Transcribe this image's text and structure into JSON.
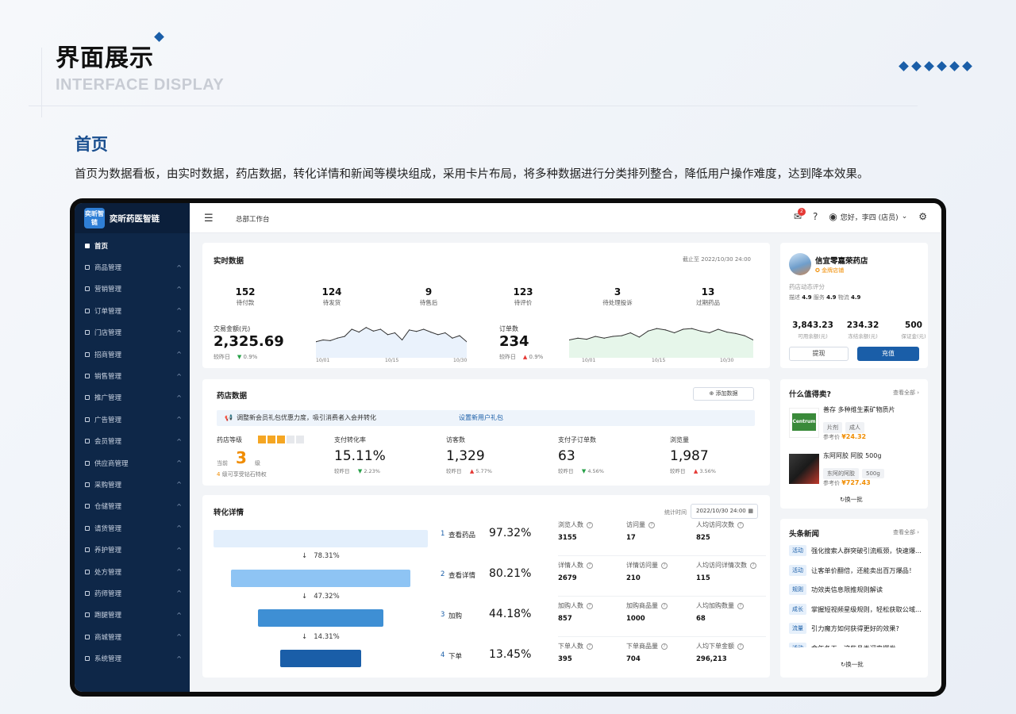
{
  "header": {
    "title": "界面展示",
    "subtitle": "INTERFACE DISPLAY",
    "section_title": "首页",
    "section_desc": "首页为数据看板，由实时数据，药店数据，转化详情和新闻等模块组成，采用卡片布局，将多种数据进行分类排列整合，降低用户操作难度，达到降本效果。"
  },
  "colors": {
    "primary": "#1a5ea8",
    "sidebar": "#0e2748",
    "up": "#e53935",
    "down": "#27a048",
    "price": "#f08c00"
  },
  "app": {
    "brand": "奕昕药医智链",
    "logo_text": "奕昕智链",
    "breadcrumb": "总部工作台",
    "notif_count": "2",
    "help": "?",
    "user": "您好，李四 (店员)",
    "user_chevron": "⌄"
  },
  "sidebar": {
    "items": [
      {
        "label": "首页",
        "active": true
      },
      {
        "label": "商品管理"
      },
      {
        "label": "营销管理"
      },
      {
        "label": "订单管理"
      },
      {
        "label": "门店管理"
      },
      {
        "label": "招商管理"
      },
      {
        "label": "销售管理"
      },
      {
        "label": "推广管理"
      },
      {
        "label": "广告管理"
      },
      {
        "label": "会员管理"
      },
      {
        "label": "供应商管理"
      },
      {
        "label": "采购管理"
      },
      {
        "label": "仓储管理"
      },
      {
        "label": "请货管理"
      },
      {
        "label": "养护管理"
      },
      {
        "label": "处方管理"
      },
      {
        "label": "药师管理"
      },
      {
        "label": "跑腿管理"
      },
      {
        "label": "商城管理"
      },
      {
        "label": "系统管理"
      }
    ]
  },
  "realtime": {
    "title": "实时数据",
    "as_of": "截止至 2022/10/30 24:00",
    "stats": [
      {
        "value": "152",
        "label": "待付款"
      },
      {
        "value": "124",
        "label": "待发货"
      },
      {
        "value": "9",
        "label": "待售后"
      },
      {
        "value": "123",
        "label": "待评价"
      },
      {
        "value": "3",
        "label": "待处理投诉"
      },
      {
        "value": "13",
        "label": "过期药品"
      }
    ],
    "amount": {
      "label": "交易金额(元)",
      "value": "2,325.69",
      "cmp_label": "较昨日",
      "change": "0.9%",
      "ticks": [
        "10/01",
        "10/15",
        "10/30"
      ]
    },
    "orders": {
      "label": "订单数",
      "value": "234",
      "cmp_label": "较昨日",
      "change": "0.9%",
      "ticks": [
        "10/01",
        "10/15",
        "10/30"
      ]
    }
  },
  "store": {
    "title": "药店数据",
    "add_btn": "添加数据",
    "notice": "调整新会员礼包优惠力度，吸引消费者入会并转化",
    "notice_link": "设置新用户礼包",
    "level_label": "药店等级",
    "level_prefix": "当前",
    "level_value": "3",
    "level_suffix": "级",
    "level_tip": "级可享受钻石特权",
    "level_tip_num": "4",
    "level_filled": 3,
    "level_total": 5,
    "metrics": [
      {
        "label": "支付转化率",
        "value": "15.11%",
        "cmp": "较昨日",
        "change": "2.23%",
        "dir": "down"
      },
      {
        "label": "访客数",
        "value": "1,329",
        "cmp": "较昨日",
        "change": "5.77%",
        "dir": "up"
      },
      {
        "label": "支付子订单数",
        "value": "63",
        "cmp": "较昨日",
        "change": "4.56%",
        "dir": "down"
      },
      {
        "label": "浏览量",
        "value": "1,987",
        "cmp": "较昨日",
        "change": "3.56%",
        "dir": "up"
      }
    ]
  },
  "conversion": {
    "title": "转化详情",
    "time_label": "统计时间",
    "date": "2022/10/30 24:00",
    "funnel_pcts": [
      "78.31%",
      "47.32%",
      "14.31%"
    ],
    "rows": [
      {
        "idx": "1",
        "name": "查看药品",
        "pct": "97.32%",
        "cells": [
          {
            "l": "浏览人数",
            "v": "3155"
          },
          {
            "l": "访问量",
            "v": "17"
          },
          {
            "l": "人均访问次数",
            "v": "825"
          }
        ]
      },
      {
        "idx": "2",
        "name": "查看详情",
        "pct": "80.21%",
        "cells": [
          {
            "l": "详情人数",
            "v": "2679"
          },
          {
            "l": "详情访问量",
            "v": "210"
          },
          {
            "l": "人均访问详情次数",
            "v": "115"
          }
        ]
      },
      {
        "idx": "3",
        "name": "加购",
        "pct": "44.18%",
        "cells": [
          {
            "l": "加购人数",
            "v": "857"
          },
          {
            "l": "加购商品量",
            "v": "1000"
          },
          {
            "l": "人均加购数量",
            "v": "68"
          }
        ]
      },
      {
        "idx": "4",
        "name": "下单",
        "pct": "13.45%",
        "cells": [
          {
            "l": "下单人数",
            "v": "395"
          },
          {
            "l": "下单商品量",
            "v": "704"
          },
          {
            "l": "人均下单金额",
            "v": "296,213"
          }
        ]
      }
    ]
  },
  "shop": {
    "name": "信宜零嘉荣药店",
    "badge": "金牌店铺",
    "rating_title": "药店动态评分",
    "ratings": [
      {
        "l": "描述",
        "v": "4.9"
      },
      {
        "l": "服务",
        "v": "4.9"
      },
      {
        "l": "物流",
        "v": "4.9"
      }
    ],
    "balances": [
      {
        "v": "3,843.23",
        "l": "可用余额(元)"
      },
      {
        "v": "234.32",
        "l": "冻结余额(元)"
      },
      {
        "v": "500",
        "l": "保证金(元)"
      }
    ],
    "withdraw": "提现",
    "recharge": "充值"
  },
  "recommend": {
    "title": "什么值得卖?",
    "view_all": "查看全部",
    "items": [
      {
        "name": "善存 多种维生素矿物质片",
        "tags": [
          "片剂",
          "成人"
        ],
        "price_label": "参考价",
        "price": "¥24.32",
        "img": "Centrum"
      },
      {
        "name": "东阿阿胶 阿胶 500g",
        "tags": [
          "东阿的阿胶",
          "500g"
        ],
        "price_label": "参考价",
        "price": "¥727.43",
        "img": ""
      }
    ],
    "refresh": "换一批"
  },
  "news": {
    "title": "头条新闻",
    "view_all": "查看全部",
    "items": [
      {
        "tag": "活动",
        "text": "强化搜索人群突破引流瓶颈，快速爆..."
      },
      {
        "tag": "活动",
        "text": "让客单价翻倍，还能卖出百万爆品！"
      },
      {
        "tag": "规则",
        "text": "功效类信息限推规则解读"
      },
      {
        "tag": "成长",
        "text": "掌握短视频星级规则，轻松获取公域..."
      },
      {
        "tag": "流量",
        "text": "引力魔方如何获得更好的效果?"
      },
      {
        "tag": "活动",
        "text": "金年冬天，这些品类迎来爆发"
      }
    ],
    "refresh": "换一批"
  },
  "chart_data": [
    {
      "type": "area",
      "title": "",
      "x": [
        "10/01",
        "10/15",
        "10/30"
      ],
      "series": [
        {
          "values": [
            0.45,
            0.5,
            0.48,
            0.55,
            0.6,
            0.8,
            0.72,
            0.85,
            0.75,
            0.8,
            0.65,
            0.7,
            0.5,
            0.78,
            0.74,
            0.8,
            0.72,
            0.65,
            0.7,
            0.55,
            0.62,
            0.45
          ]
        }
      ]
    },
    {
      "type": "area",
      "title": "",
      "x": [
        "10/01",
        "10/15",
        "10/30"
      ],
      "series": [
        {
          "values": [
            0.5,
            0.55,
            0.52,
            0.6,
            0.55,
            0.6,
            0.62,
            0.7,
            0.58,
            0.75,
            0.82,
            0.78,
            0.7,
            0.8,
            0.82,
            0.75,
            0.7,
            0.8,
            0.72,
            0.68,
            0.62,
            0.5
          ]
        }
      ]
    }
  ]
}
